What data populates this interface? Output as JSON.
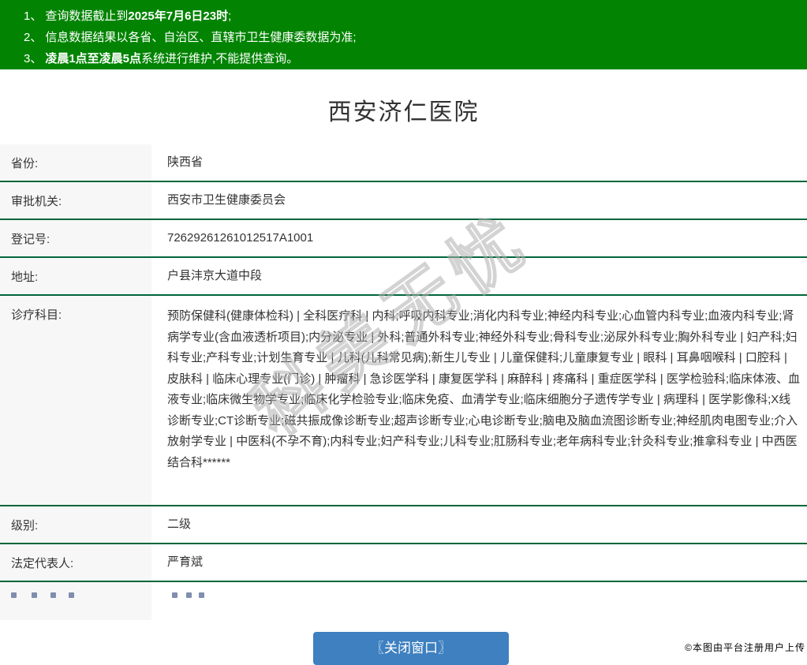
{
  "notice": {
    "items": [
      {
        "num": "1、",
        "segments": [
          {
            "text": "查询数据截止到",
            "bold": false
          },
          {
            "text": "2025年7月6日23时",
            "bold": true
          },
          {
            "text": ";",
            "bold": false
          }
        ]
      },
      {
        "num": "2、",
        "segments": [
          {
            "text": "信息数据结果以各省、自治区、直辖市卫生健康委数据为准;",
            "bold": false
          }
        ]
      },
      {
        "num": "3、",
        "segments": [
          {
            "text": "凌晨1点至凌晨5点",
            "bold": true
          },
          {
            "text": "系统进行维护,不能提供查询。",
            "bold": false
          }
        ]
      }
    ]
  },
  "title": "西安济仁医院",
  "table": {
    "rows": [
      {
        "label": "省份:",
        "value": "陕西省"
      },
      {
        "label": "审批机关:",
        "value": "西安市卫生健康委员会"
      },
      {
        "label": "登记号:",
        "value": "72629261261012517A1001"
      },
      {
        "label": "地址:",
        "value": "户县沣京大道中段"
      },
      {
        "label": "诊疗科目:",
        "value": "预防保健科(健康体检科) | 全科医疗科 | 内科;呼吸内科专业;消化内科专业;神经内科专业;心血管内科专业;血液内科专业;肾病学专业(含血液透析项目);内分泌专业 | 外科;普通外科专业;神经外科专业;骨科专业;泌尿外科专业;胸外科专业 | 妇产科;妇科专业;产科专业;计划生育专业 | 儿科(儿科常见病);新生儿专业 | 儿童保健科;儿童康复专业 | 眼科 | 耳鼻咽喉科 | 口腔科 | 皮肤科 | 临床心理专业(门诊) | 肿瘤科 | 急诊医学科 | 康复医学科 | 麻醉科 | 疼痛科 | 重症医学科 | 医学检验科;临床体液、血液专业;临床微生物学专业;临床化学检验专业;临床免疫、血清学专业;临床细胞分子遗传学专业 | 病理科 | 医学影像科;X线诊断专业;CT诊断专业;磁共振成像诊断专业;超声诊断专业;心电诊断专业;脑电及脑血流图诊断专业;神经肌肉电图专业;介入放射学专业 | 中医科(不孕不育);内科专业;妇产科专业;儿科专业;肛肠科专业;老年病科专业;针灸科专业;推拿科专业 | 中西医结合科******"
      },
      {
        "label": "级别:",
        "value": "二级"
      },
      {
        "label": "法定代表人:",
        "value": "严育斌"
      }
    ]
  },
  "watermark": "科美无忧",
  "footer": {
    "close_button_label": "〖关闭窗口〗",
    "copyright": "©本图由平台注册用户上传"
  },
  "colors": {
    "banner_green": "#028402",
    "row_border_green": "#00663b",
    "label_bg": "#f7f7f7",
    "button_blue": "#3e80c0",
    "text": "#333333"
  }
}
